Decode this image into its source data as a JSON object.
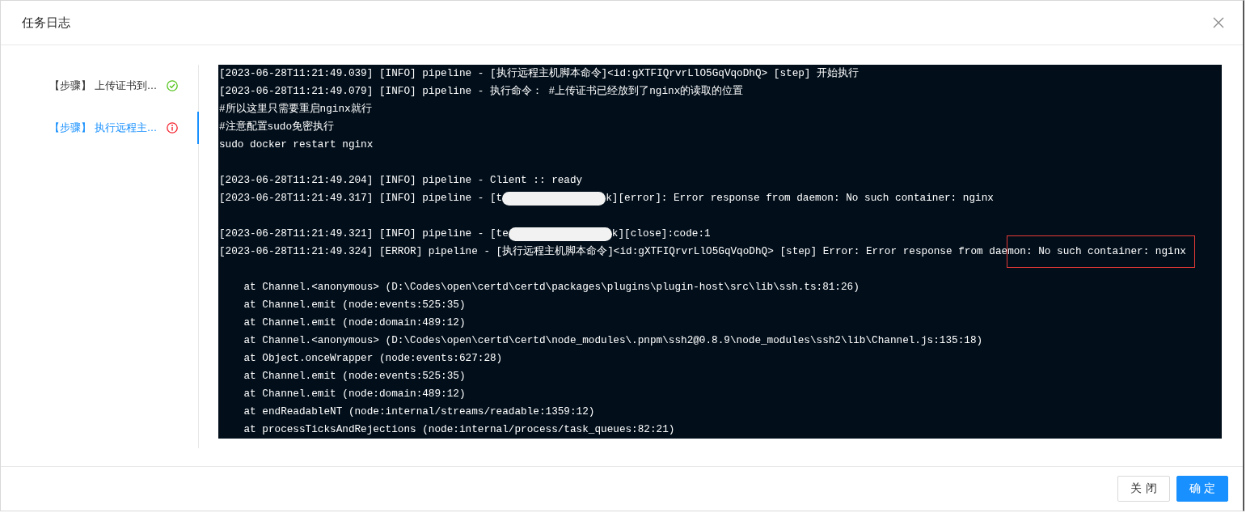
{
  "dialog": {
    "title": "任务日志"
  },
  "steps": [
    {
      "label": "【步骤】 上传证书到...",
      "kind": "success",
      "selected": false
    },
    {
      "label": "【步骤】 执行远程主...",
      "kind": "error",
      "selected": true
    }
  ],
  "log": [
    {
      "kind": "text",
      "text": "[2023-06-28T11:21:49.039] [INFO] pipeline - [执行远程主机脚本命令]<id:gXTFIQrvrLlO5GqVqoDhQ> [step] 开始执行"
    },
    {
      "kind": "text",
      "text": "[2023-06-28T11:21:49.079] [INFO] pipeline - 执行命令： #上传证书已经放到了nginx的读取的位置"
    },
    {
      "kind": "text",
      "text": "#所以这里只需要重启nginx就行"
    },
    {
      "kind": "text",
      "text": "#注意配置sudo免密执行"
    },
    {
      "kind": "text",
      "text": "sudo docker restart nginx"
    },
    {
      "kind": "blank"
    },
    {
      "kind": "text",
      "text": "[2023-06-28T11:21:49.204] [INFO] pipeline - Client :: ready"
    },
    {
      "kind": "redacted",
      "text": "[2023-06-28T11:21:49.317] [INFO] pipeline - [t",
      "after": "k][error]: Error response from daemon: No such container: nginx"
    },
    {
      "kind": "blank"
    },
    {
      "kind": "redacted",
      "text": "[2023-06-28T11:21:49.321] [INFO] pipeline - [te",
      "after": "k][close]:code:1"
    },
    {
      "kind": "highlighted",
      "text": "[2023-06-28T11:21:49.324] [ERROR] pipeline - [执行远程主机脚本命令]<id:gXTFIQrvrLlO5GqVqoDhQ> [step] Error: Error response from dae",
      "highlight": "mon: No such container: nginx"
    },
    {
      "kind": "blank"
    },
    {
      "kind": "text",
      "text": "    at Channel.<anonymous> (D:\\Codes\\open\\certd\\certd\\packages\\plugins\\plugin-host\\src\\lib\\ssh.ts:81:26)"
    },
    {
      "kind": "text",
      "text": "    at Channel.emit (node:events:525:35)"
    },
    {
      "kind": "text",
      "text": "    at Channel.emit (node:domain:489:12)"
    },
    {
      "kind": "text",
      "text": "    at Channel.<anonymous> (D:\\Codes\\open\\certd\\certd\\node_modules\\.pnpm\\ssh2@0.8.9\\node_modules\\ssh2\\lib\\Channel.js:135:18)"
    },
    {
      "kind": "text",
      "text": "    at Object.onceWrapper (node:events:627:28)"
    },
    {
      "kind": "text",
      "text": "    at Channel.emit (node:events:525:35)"
    },
    {
      "kind": "text",
      "text": "    at Channel.emit (node:domain:489:12)"
    },
    {
      "kind": "text",
      "text": "    at endReadableNT (node:internal/streams/readable:1359:12)"
    },
    {
      "kind": "text",
      "text": "    at processTicksAndRejections (node:internal/process/task_queues:82:21)"
    }
  ],
  "buttons": [
    {
      "label": "关 闭",
      "kind": "default"
    },
    {
      "label": "确 定",
      "kind": "primary"
    }
  ]
}
